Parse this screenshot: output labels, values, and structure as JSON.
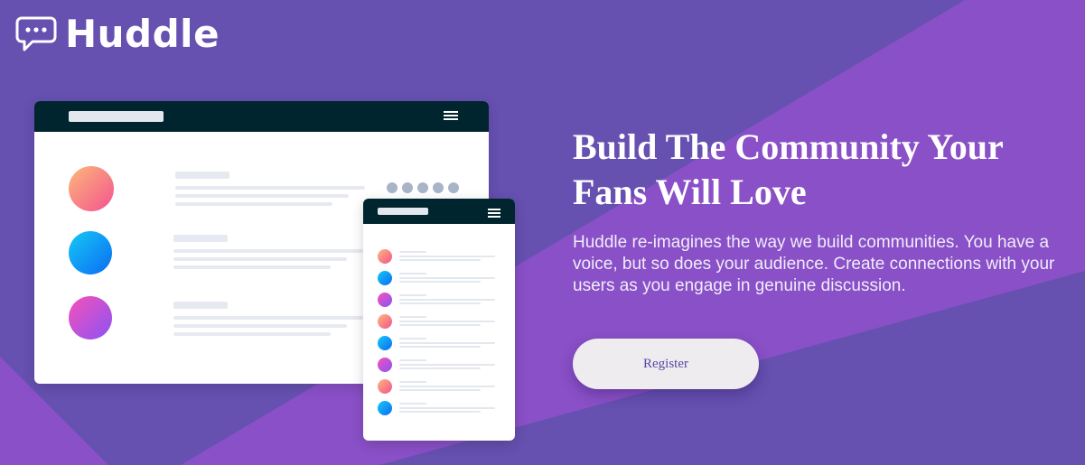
{
  "brand": {
    "name": "Huddle",
    "icon": "chat-bubble-icon"
  },
  "hero": {
    "headline": "Build The Community Your Fans Will Love",
    "description": "Huddle re-imagines the way we build communities. You have a voice, but so does your audience. Create connections with your users as you engage in genuine discussion."
  },
  "cta": {
    "register_label": "Register"
  },
  "colors": {
    "background": "#6650b0",
    "accent_violet": "#8f52cc",
    "app_bar": "#00252e",
    "button_bg": "#eeecef",
    "button_text": "#5a46a3"
  },
  "illustration": {
    "desktop_avatar_count": 3,
    "mobile_avatar_count": 8
  }
}
